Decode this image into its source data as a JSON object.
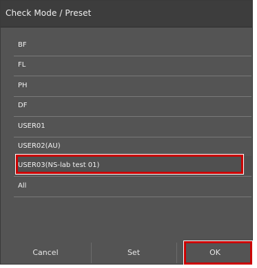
{
  "dialog": {
    "title": "Check Mode / Preset"
  },
  "list": {
    "items": [
      {
        "label": "BF",
        "selected": false
      },
      {
        "label": "FL",
        "selected": false
      },
      {
        "label": "PH",
        "selected": false
      },
      {
        "label": "DF",
        "selected": false
      },
      {
        "label": "USER01",
        "selected": false
      },
      {
        "label": "USER02(AU)",
        "selected": false
      },
      {
        "label": "USER03(NS-lab test 01)",
        "selected": true
      },
      {
        "label": "All",
        "selected": false
      }
    ]
  },
  "buttons": {
    "cancel_label": "Cancel",
    "set_label": "Set",
    "ok_label": "OK"
  },
  "colors": {
    "dialog_background": "#545454",
    "titlebar_background": "#3d3d3d",
    "highlight_border": "#cc0000"
  }
}
